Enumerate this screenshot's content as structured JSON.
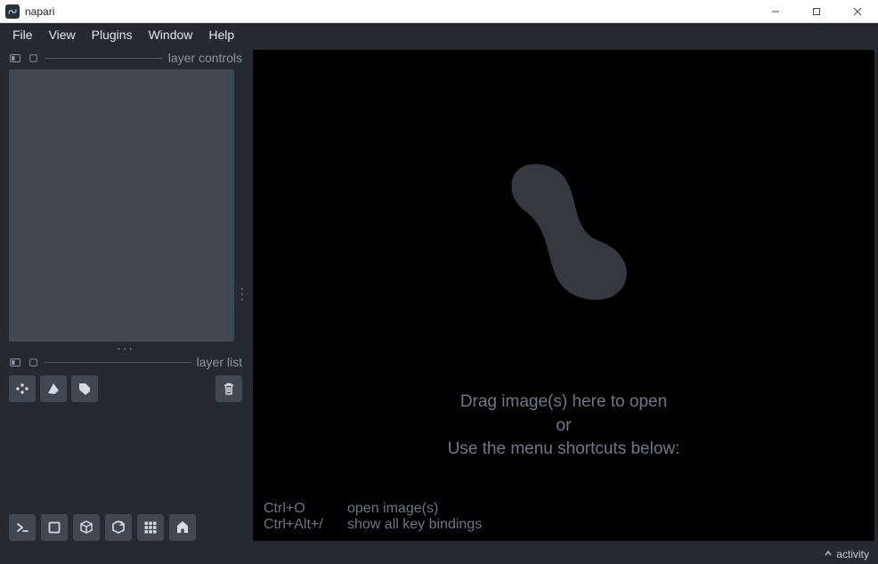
{
  "window": {
    "title": "napari"
  },
  "menubar": {
    "items": [
      "File",
      "View",
      "Plugins",
      "Window",
      "Help"
    ]
  },
  "sidebar": {
    "layer_controls_label": "layer controls",
    "layer_list_label": "layer list"
  },
  "viewer": {
    "drag_line": "Drag image(s) here to open",
    "or_line": "or",
    "menu_line": "Use the menu shortcuts below:",
    "shortcuts": [
      {
        "keys": "Ctrl+O",
        "desc": "open image(s)"
      },
      {
        "keys": "Ctrl+Alt+/",
        "desc": "show all key bindings"
      }
    ]
  },
  "statusbar": {
    "activity_label": "activity"
  }
}
